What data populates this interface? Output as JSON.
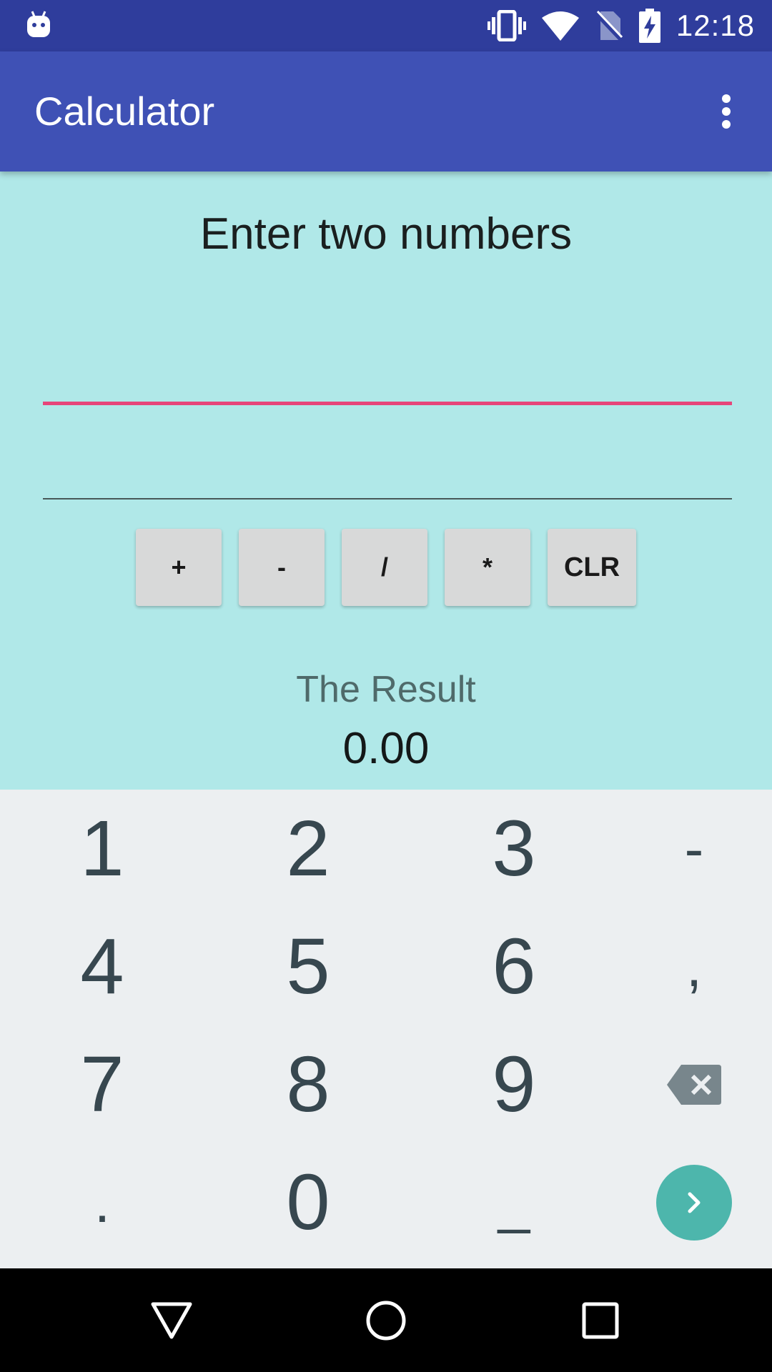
{
  "status_bar": {
    "time": "12:18"
  },
  "app_bar": {
    "title": "Calculator"
  },
  "main": {
    "heading": "Enter two numbers",
    "input1": {
      "value": "",
      "placeholder": ""
    },
    "input2": {
      "value": "",
      "placeholder": ""
    },
    "operators": [
      "+",
      "-",
      "/",
      "*",
      "CLR"
    ],
    "result_label": "The Result",
    "result_value": "0.00"
  },
  "keypad": {
    "keys": [
      "1",
      "2",
      "3",
      "-",
      "4",
      "5",
      "6",
      ",",
      "7",
      "8",
      "9",
      ".",
      "0",
      "_"
    ]
  },
  "colors": {
    "status_bar": "#2f3d9c",
    "app_bar": "#3f51b5",
    "background": "#b0e8e8",
    "accent": "#e6457a",
    "keypad_bg": "#eceff1",
    "go_button": "#4db6ac"
  },
  "icons": [
    "android-robot-icon",
    "vibrate-icon",
    "wifi-icon",
    "no-sim-icon",
    "battery-charging-icon",
    "overflow-menu-icon",
    "backspace-icon",
    "next-arrow-icon",
    "back-icon",
    "home-icon",
    "recents-icon"
  ]
}
